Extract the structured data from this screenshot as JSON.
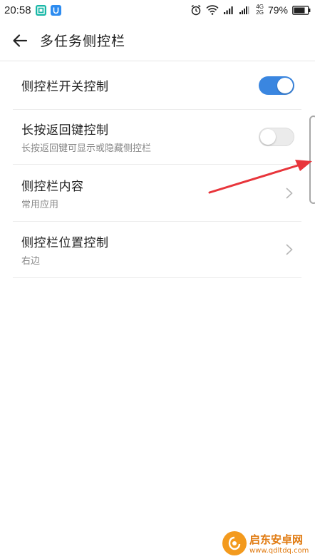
{
  "status_bar": {
    "time": "20:58",
    "network_top": "4G",
    "network_bottom": "2G",
    "battery_percent": "79%"
  },
  "app_bar": {
    "title": "多任务侧控栏"
  },
  "settings": [
    {
      "title": "侧控栏开关控制",
      "subtitle": "",
      "control": "toggle",
      "state": "on"
    },
    {
      "title": "长按返回键控制",
      "subtitle": "长按返回键可显示或隐藏侧控栏",
      "control": "toggle",
      "state": "off"
    },
    {
      "title": "侧控栏内容",
      "subtitle": "常用应用",
      "control": "chevron"
    },
    {
      "title": "侧控栏位置控制",
      "subtitle": "右边",
      "control": "chevron"
    }
  ],
  "watermark": {
    "title": "启东安卓网",
    "url": "www.qdltdq.com"
  },
  "colors": {
    "accent": "#3a86e0",
    "annotation": "#e8353b",
    "watermark": "#e07a10"
  }
}
